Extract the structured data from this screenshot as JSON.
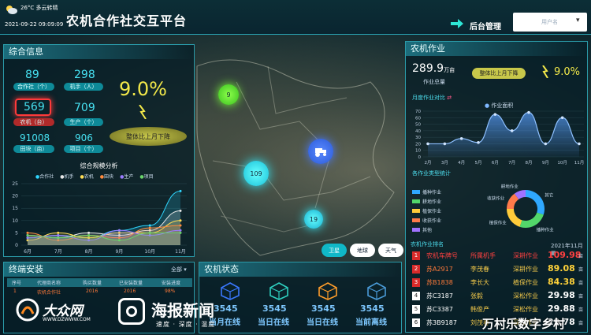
{
  "header": {
    "weather_temp": "26°C",
    "weather_desc": "多云转晴",
    "datetime": "2021-09-22 09:09:09",
    "title": "农机合作社交互平台",
    "admin_label": "后台管理",
    "user_placeholder": "用户名"
  },
  "summary": {
    "title": "综合信息",
    "stats": [
      {
        "value": "89",
        "label": "合作社（个）"
      },
      {
        "value": "298",
        "label": "机手（人）"
      },
      {
        "value": "569",
        "label": "农机（台）"
      },
      {
        "value": "709",
        "label": "生产（个）"
      },
      {
        "value": "91008",
        "label": "田块（亩）"
      },
      {
        "value": "906",
        "label": "项目（个）"
      }
    ],
    "percent": "9.0%",
    "compare_label": "整体比上月下降"
  },
  "scale_chart": {
    "title": "综合规模分析",
    "legend": [
      "合作社",
      "机手",
      "农机",
      "田块",
      "生产",
      "项目"
    ],
    "colors": [
      "#2fd6ff",
      "#e8e8e8",
      "#ffdd55",
      "#ff8a3d",
      "#9a7bff",
      "#6ad36a"
    ],
    "x": [
      "6月",
      "7月",
      "8月",
      "9月",
      "10月",
      "11月"
    ],
    "yticks": [
      "0",
      "5",
      "10",
      "15",
      "20",
      "25"
    ],
    "ylim": [
      0,
      25
    ],
    "series": [
      {
        "values": [
          3,
          4,
          3,
          6,
          8,
          22
        ]
      },
      {
        "values": [
          4,
          3,
          5,
          4,
          6,
          14
        ]
      },
      {
        "values": [
          2,
          5,
          3,
          5,
          5,
          10
        ]
      },
      {
        "values": [
          5,
          2,
          4,
          3,
          7,
          8
        ]
      },
      {
        "values": [
          3,
          4,
          2,
          6,
          4,
          6
        ]
      },
      {
        "values": [
          4,
          3,
          4,
          2,
          5,
          5
        ]
      }
    ]
  },
  "map": {
    "bubbles": [
      "9",
      "109",
      "19"
    ],
    "buttons": [
      "卫星",
      "地球",
      "天气"
    ]
  },
  "terminal": {
    "title": "终端安装",
    "all_label": "全部",
    "columns": [
      "序号",
      "代理商名称",
      "购买数量",
      "已安装数量",
      "安装进度"
    ],
    "rows": [
      [
        "1",
        "农机合作社",
        "2016",
        "2016",
        "98%"
      ]
    ]
  },
  "status": {
    "title": "农机状态",
    "items": [
      {
        "value": "3545",
        "label": "当月在线",
        "color": "#3a78ff"
      },
      {
        "value": "3545",
        "label": "当日在线",
        "color": "#2fd0c0"
      },
      {
        "value": "3545",
        "label": "当日在线",
        "color": "#ff9d2a"
      },
      {
        "value": "3545",
        "label": "当前离线",
        "color": "#4a9bd8"
      }
    ]
  },
  "work": {
    "title": "农机作业",
    "total": "289.9",
    "total_unit": "万亩",
    "total_label": "作业总量",
    "compare_label": "整体比上月下降",
    "percent": "9.0%"
  },
  "monthly": {
    "title": "月度作业对比",
    "legend": "作业面积",
    "x": [
      "2月",
      "3月",
      "4月",
      "5月",
      "6月",
      "7月",
      "8月",
      "9月",
      "10月",
      "11月"
    ],
    "yticks": [
      "0",
      "10",
      "20",
      "30",
      "40",
      "50",
      "60",
      "70"
    ],
    "values": [
      20,
      20,
      28,
      22,
      65,
      40,
      68,
      20,
      60,
      20
    ],
    "ylim": [
      0,
      70
    ]
  },
  "types": {
    "title": "各作业类型统计",
    "legend": [
      "播种作业",
      "耕地作业",
      "植保作业",
      "收获作业",
      "其他"
    ],
    "colors": [
      "#2fa8ff",
      "#52d66a",
      "#ffcb3a",
      "#ff7a4a",
      "#a072ff"
    ],
    "values": [
      30,
      25,
      20,
      15,
      10
    ],
    "labels": [
      "其它",
      "播种作业",
      "植保作业",
      "收获作业",
      "耕地作业"
    ]
  },
  "ranking": {
    "title": "农机作业排名",
    "date": "2021年11月",
    "rows": [
      {
        "rank": "1",
        "plate": "农机车牌号",
        "owner": "所属机手",
        "type": "深耕作业",
        "value": "109.98",
        "unit": "亩"
      },
      {
        "rank": "2",
        "plate": "苏A2917",
        "owner": "李茂春",
        "type": "深耕作业",
        "value": "89.08",
        "unit": "亩"
      },
      {
        "rank": "3",
        "plate": "苏B1838",
        "owner": "李长大",
        "type": "植保作业",
        "value": "84.38",
        "unit": "亩"
      },
      {
        "rank": "4",
        "plate": "苏C3187",
        "owner": "张毅",
        "type": "深松作业",
        "value": "29.98",
        "unit": "亩"
      },
      {
        "rank": "5",
        "plate": "苏C3387",
        "owner": "韩俊产",
        "type": "深松作业",
        "value": "29.88",
        "unit": "亩"
      },
      {
        "rank": "6",
        "plate": "苏3B9187",
        "owner": "刘茂春",
        "type": "深松作业",
        "value": "29.78",
        "unit": "亩"
      }
    ]
  },
  "watermarks": {
    "dazhong": "大众网",
    "dazhong_url": "WWW.DZWWW.COM",
    "haibao": "海报新闻",
    "haibao_sub": "速度 · 深度 · 温度",
    "village": "万村乐数字乡村"
  }
}
